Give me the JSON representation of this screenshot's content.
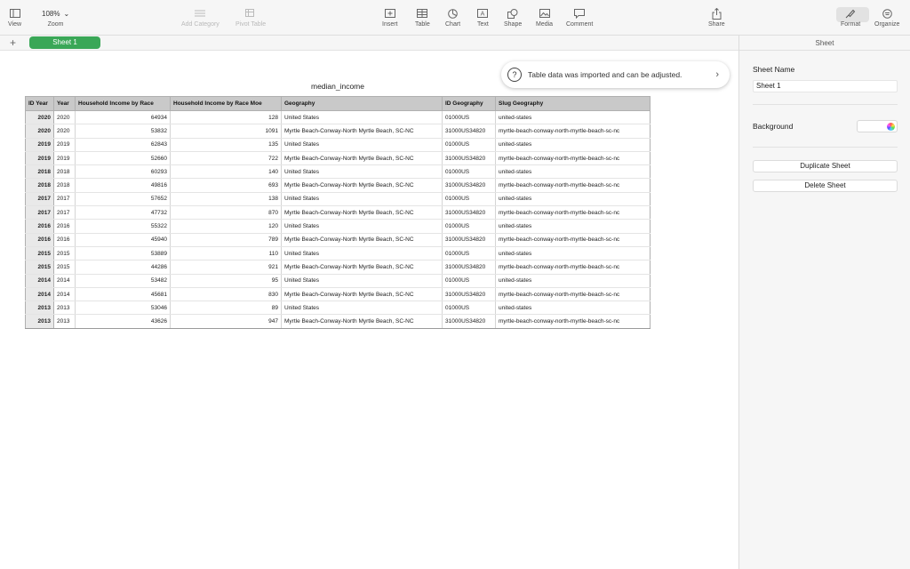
{
  "toolbar": {
    "view_label": "View",
    "zoom_value": "108%",
    "zoom_label": "Zoom",
    "add_category_label": "Add Category",
    "pivot_table_label": "Pivot Table",
    "insert_label": "Insert",
    "table_label": "Table",
    "chart_label": "Chart",
    "text_label": "Text",
    "shape_label": "Shape",
    "media_label": "Media",
    "comment_label": "Comment",
    "share_label": "Share",
    "format_label": "Format",
    "organize_label": "Organize"
  },
  "tabs": {
    "add_symbol": "+",
    "active_sheet": "Sheet 1"
  },
  "toast": {
    "icon": "?",
    "message": "Table data was imported and can be adjusted.",
    "chevron": "›"
  },
  "table": {
    "title": "median_income",
    "headers": [
      "ID Year",
      "Year",
      "Household Income by Race",
      "Household Income by Race Moe",
      "Geography",
      "ID Geography",
      "Slug Geography"
    ],
    "rows": [
      [
        "2020",
        "2020",
        "64934",
        "128",
        "United States",
        "01000US",
        "united-states"
      ],
      [
        "2020",
        "2020",
        "53832",
        "1091",
        "Myrtle Beach-Conway-North Myrtle Beach, SC-NC",
        "31000US34820",
        "myrtle-beach-conway-north-myrtle-beach-sc-nc"
      ],
      [
        "2019",
        "2019",
        "62843",
        "135",
        "United States",
        "01000US",
        "united-states"
      ],
      [
        "2019",
        "2019",
        "52660",
        "722",
        "Myrtle Beach-Conway-North Myrtle Beach, SC-NC",
        "31000US34820",
        "myrtle-beach-conway-north-myrtle-beach-sc-nc"
      ],
      [
        "2018",
        "2018",
        "60293",
        "140",
        "United States",
        "01000US",
        "united-states"
      ],
      [
        "2018",
        "2018",
        "49816",
        "693",
        "Myrtle Beach-Conway-North Myrtle Beach, SC-NC",
        "31000US34820",
        "myrtle-beach-conway-north-myrtle-beach-sc-nc"
      ],
      [
        "2017",
        "2017",
        "57652",
        "138",
        "United States",
        "01000US",
        "united-states"
      ],
      [
        "2017",
        "2017",
        "47732",
        "870",
        "Myrtle Beach-Conway-North Myrtle Beach, SC-NC",
        "31000US34820",
        "myrtle-beach-conway-north-myrtle-beach-sc-nc"
      ],
      [
        "2016",
        "2016",
        "55322",
        "120",
        "United States",
        "01000US",
        "united-states"
      ],
      [
        "2016",
        "2016",
        "45940",
        "789",
        "Myrtle Beach-Conway-North Myrtle Beach, SC-NC",
        "31000US34820",
        "myrtle-beach-conway-north-myrtle-beach-sc-nc"
      ],
      [
        "2015",
        "2015",
        "53889",
        "110",
        "United States",
        "01000US",
        "united-states"
      ],
      [
        "2015",
        "2015",
        "44286",
        "921",
        "Myrtle Beach-Conway-North Myrtle Beach, SC-NC",
        "31000US34820",
        "myrtle-beach-conway-north-myrtle-beach-sc-nc"
      ],
      [
        "2014",
        "2014",
        "53482",
        "95",
        "United States",
        "01000US",
        "united-states"
      ],
      [
        "2014",
        "2014",
        "45681",
        "830",
        "Myrtle Beach-Conway-North Myrtle Beach, SC-NC",
        "31000US34820",
        "myrtle-beach-conway-north-myrtle-beach-sc-nc"
      ],
      [
        "2013",
        "2013",
        "53046",
        "89",
        "United States",
        "01000US",
        "united-states"
      ],
      [
        "2013",
        "2013",
        "43626",
        "947",
        "Myrtle Beach-Conway-North Myrtle Beach, SC-NC",
        "31000US34820",
        "myrtle-beach-conway-north-myrtle-beach-sc-nc"
      ]
    ]
  },
  "sidebar": {
    "header": "Sheet",
    "sheet_name_label": "Sheet Name",
    "sheet_name_value": "Sheet 1",
    "background_label": "Background",
    "duplicate_label": "Duplicate Sheet",
    "delete_label": "Delete Sheet"
  },
  "colors": {
    "tab_active": "#3aa757",
    "header_fill": "#c9c9c9"
  }
}
